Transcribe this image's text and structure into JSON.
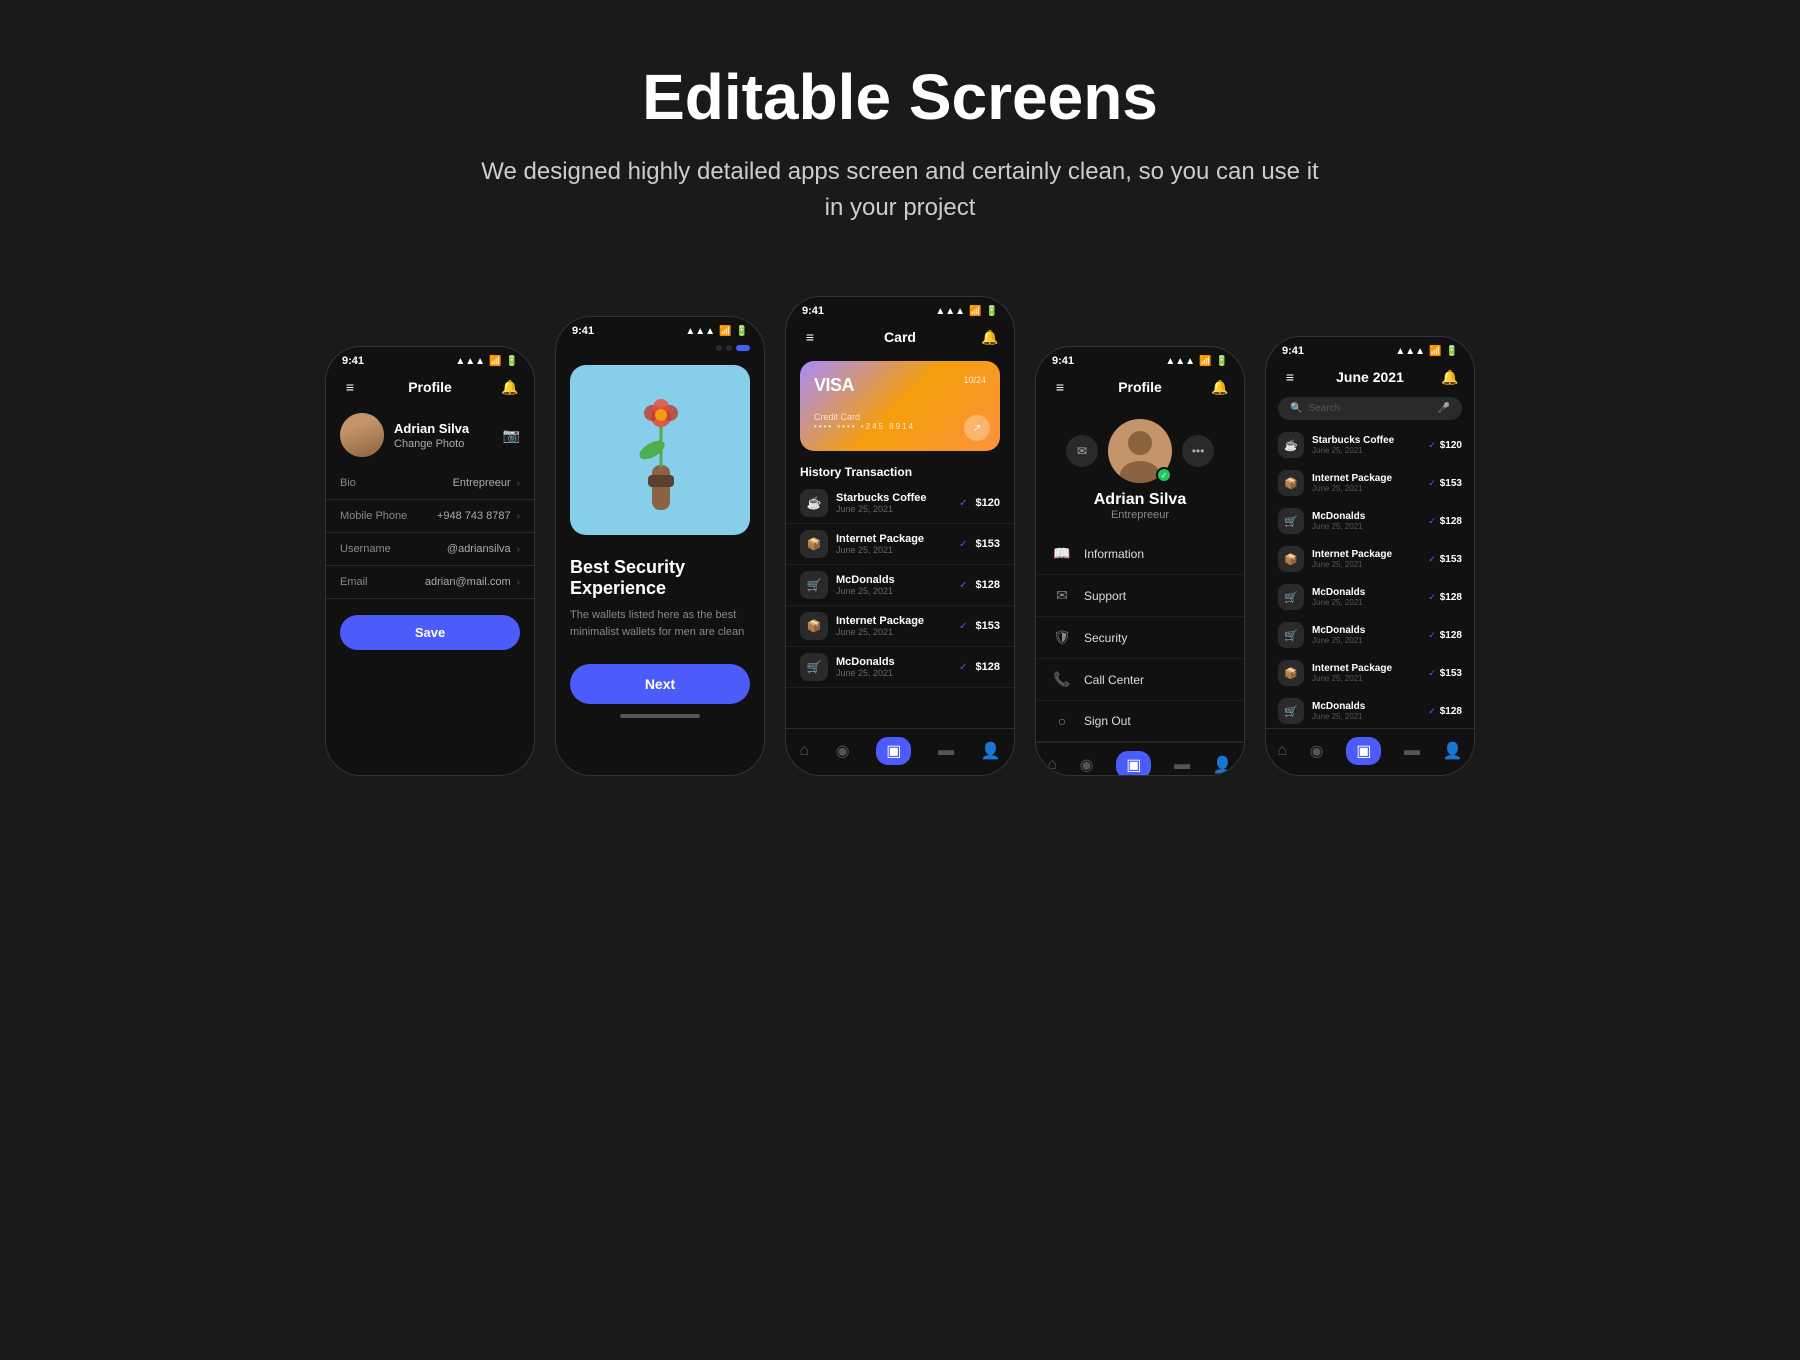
{
  "header": {
    "title": "Editable Screens",
    "subtitle": "We designed highly detailed apps screen and certainly clean, so you can use it in your project"
  },
  "phone1": {
    "status_time": "9:41",
    "nav_title": "Profile",
    "user_name": "Adrian Silva",
    "change_photo": "Change Photo",
    "fields": [
      {
        "label": "Bio",
        "value": "Entrepreeur",
        "has_chevron": true
      },
      {
        "label": "Mobile Phone",
        "value": "+948 743 8787",
        "has_chevron": true
      },
      {
        "label": "Username",
        "value": "@adriansilva",
        "has_chevron": true
      },
      {
        "label": "Email",
        "value": "adrian@mail.com",
        "has_chevron": true
      }
    ],
    "save_label": "Save"
  },
  "phone2": {
    "status_time": "9:41",
    "title": "Best Security Experience",
    "description": "The wallets listed here as the best minimalist wallets for men are clean",
    "next_label": "Next",
    "dots": [
      "inactive",
      "inactive",
      "active"
    ]
  },
  "phone3": {
    "status_time": "9:41",
    "nav_title": "Card",
    "card": {
      "brand": "VISA",
      "date": "10/24",
      "type": "Credit Card",
      "number": "•••• •••• •245 8914"
    },
    "section_title": "History Transaction",
    "transactions": [
      {
        "icon": "☕",
        "name": "Starbucks Coffee",
        "date": "June 25, 2021",
        "amount": "$120"
      },
      {
        "icon": "📦",
        "name": "Internet Package",
        "date": "June 25, 2021",
        "amount": "$153"
      },
      {
        "icon": "🛒",
        "name": "McDonalds",
        "date": "June 25, 2021",
        "amount": "$128"
      },
      {
        "icon": "📦",
        "name": "Internet Package",
        "date": "June 25, 2021",
        "amount": "$153"
      },
      {
        "icon": "🛒",
        "name": "McDonalds",
        "date": "June 25, 2021",
        "amount": "$128"
      }
    ],
    "nav_items": [
      "₣",
      "●",
      "▣",
      "▬",
      "👤"
    ]
  },
  "phone4": {
    "status_time": "9:41",
    "nav_title": "Profile",
    "user_name": "Adrian Silva",
    "user_role": "Entrepreeur",
    "menu_items": [
      {
        "icon": "📖",
        "label": "Information"
      },
      {
        "icon": "✉",
        "label": "Support"
      },
      {
        "icon": "🛡",
        "label": "Security"
      },
      {
        "icon": "📞",
        "label": "Call Center"
      },
      {
        "icon": "○",
        "label": "Sign Out"
      }
    ],
    "nav_items": [
      "₣",
      "●",
      "▣",
      "▬",
      "👤"
    ]
  },
  "phone5": {
    "status_time": "9:41",
    "month": "June 2021",
    "search_placeholder": "Search",
    "transactions": [
      {
        "icon": "☕",
        "name": "Starbucks Coffee",
        "date": "June 25, 2021",
        "amount": "$120"
      },
      {
        "icon": "📦",
        "name": "Internet Package",
        "date": "June 25, 2021",
        "amount": "$153"
      },
      {
        "icon": "🛒",
        "name": "McDonalds",
        "date": "June 25, 2021",
        "amount": "$128"
      },
      {
        "icon": "📦",
        "name": "Internet Package",
        "date": "June 25, 2021",
        "amount": "$153"
      },
      {
        "icon": "🛒",
        "name": "McDonalds",
        "date": "June 25, 2021",
        "amount": "$128"
      },
      {
        "icon": "🛒",
        "name": "McDonalds",
        "date": "June 25, 2021",
        "amount": "$128"
      },
      {
        "icon": "📦",
        "name": "Internet Package",
        "date": "June 25, 2021",
        "amount": "$153"
      },
      {
        "icon": "🛒",
        "name": "McDonalds",
        "date": "June 25, 2021",
        "amount": "$128"
      }
    ],
    "nav_items": [
      "₣",
      "●",
      "▣",
      "▬",
      "👤"
    ]
  },
  "colors": {
    "accent": "#4B5CFA",
    "background": "#1a1a1a",
    "phone_bg": "#111111",
    "card_gradient_start": "#a78bfa",
    "card_gradient_end": "#fb923c"
  }
}
